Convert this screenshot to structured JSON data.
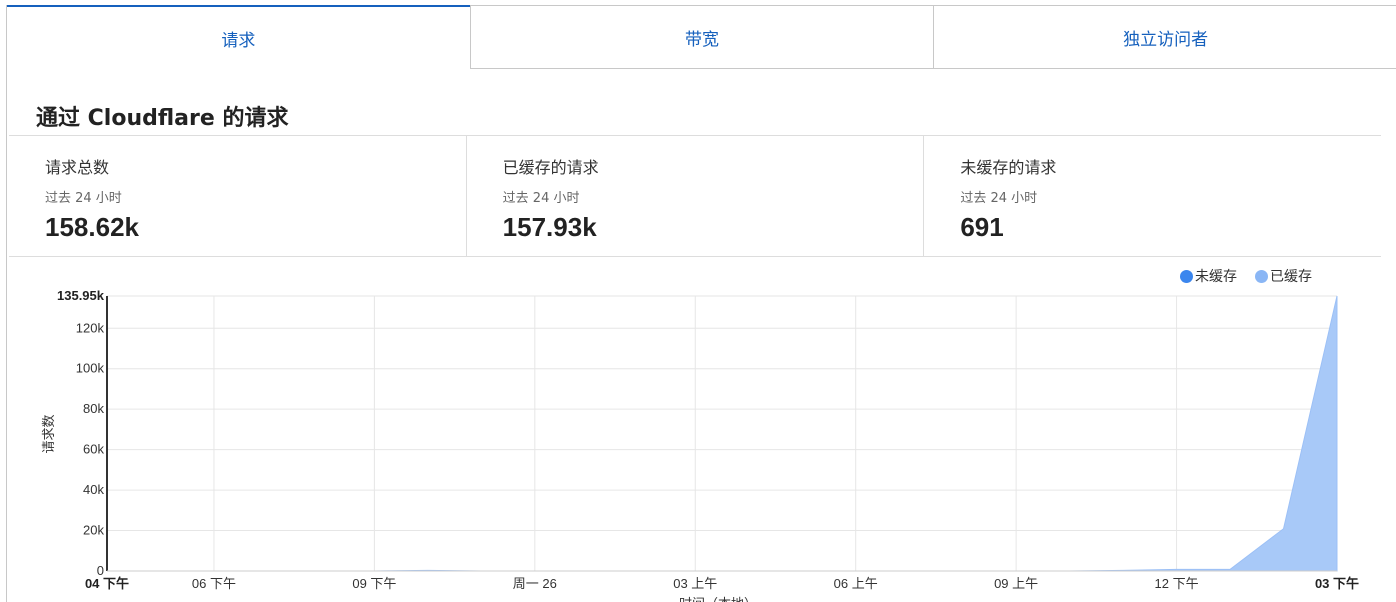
{
  "tabs": [
    {
      "label": "请求",
      "active": true
    },
    {
      "label": "带宽",
      "active": false
    },
    {
      "label": "独立访问者",
      "active": false
    }
  ],
  "section_title": "通过 Cloudflare 的请求",
  "stats": [
    {
      "label": "请求总数",
      "sub": "过去 24 小时",
      "value": "158.62k"
    },
    {
      "label": "已缓存的请求",
      "sub": "过去 24 小时",
      "value": "157.93k"
    },
    {
      "label": "未缓存的请求",
      "sub": "过去 24 小时",
      "value": "691"
    }
  ],
  "legend": [
    {
      "label": "未缓存",
      "color": "#3b86ee"
    },
    {
      "label": "已缓存",
      "color": "#8ab6f5"
    }
  ],
  "colors": {
    "accent": "#1560bd",
    "uncached": "#3b86ee",
    "cached_fill": "#a8c9f8"
  },
  "chart_data": {
    "type": "area",
    "ylabel": "请求数",
    "xlabel": "时间（本地）",
    "ylim": [
      0,
      135950
    ],
    "y_ticks": [
      "0",
      "20k",
      "40k",
      "60k",
      "80k",
      "100k",
      "120k",
      "135.95k"
    ],
    "y_tick_values": [
      0,
      20000,
      40000,
      60000,
      80000,
      100000,
      120000,
      135950
    ],
    "x_ticks": [
      "04 下午",
      "06 下午",
      "09 下午",
      "周一 26",
      "03 上午",
      "06 上午",
      "09 上午",
      "12 下午",
      "03 下午"
    ],
    "x_tick_hours": [
      0,
      2,
      5,
      8,
      11,
      14,
      17,
      20,
      23
    ],
    "x_range_hours": [
      0,
      23
    ],
    "grid": true,
    "legend_position": "top-right",
    "series": [
      {
        "name": "已缓存",
        "x_hours": [
          0,
          1,
          2,
          3,
          4,
          5,
          6,
          7,
          8,
          9,
          10,
          11,
          12,
          13,
          14,
          15,
          16,
          17,
          18,
          19,
          20,
          21,
          22,
          23
        ],
        "values": [
          0,
          0,
          0,
          0,
          0,
          0,
          300,
          0,
          0,
          0,
          0,
          0,
          0,
          0,
          0,
          0,
          0,
          0,
          0,
          300,
          800,
          800,
          20900,
          135950
        ]
      },
      {
        "name": "未缓存",
        "x_hours": [
          0,
          1,
          2,
          3,
          4,
          5,
          6,
          7,
          8,
          9,
          10,
          11,
          12,
          13,
          14,
          15,
          16,
          17,
          18,
          19,
          20,
          21,
          22,
          23
        ],
        "values": [
          0,
          0,
          0,
          0,
          0,
          0,
          0,
          0,
          0,
          0,
          0,
          0,
          0,
          0,
          0,
          0,
          0,
          0,
          0,
          0,
          0,
          0,
          0,
          0
        ]
      }
    ]
  }
}
